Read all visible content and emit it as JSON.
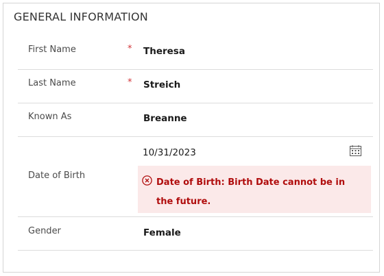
{
  "section": {
    "title": "GENERAL INFORMATION"
  },
  "fields": {
    "first_name": {
      "label": "First Name",
      "required_mark": "*",
      "value": "Theresa"
    },
    "last_name": {
      "label": "Last Name",
      "required_mark": "*",
      "value": "Streich"
    },
    "known_as": {
      "label": "Known As",
      "value": "Breanne"
    },
    "date_of_birth": {
      "label": "Date of Birth",
      "value": "10/31/2023",
      "error": "Date of Birth: Birth Date cannot be in the future."
    },
    "gender": {
      "label": "Gender",
      "value": "Female"
    }
  },
  "icons": {
    "calendar": "calendar-icon",
    "error": "error-circle-x-icon"
  },
  "colors": {
    "required": "#d13438",
    "error_text": "#b00d0d",
    "error_background": "#fbe9e9"
  }
}
